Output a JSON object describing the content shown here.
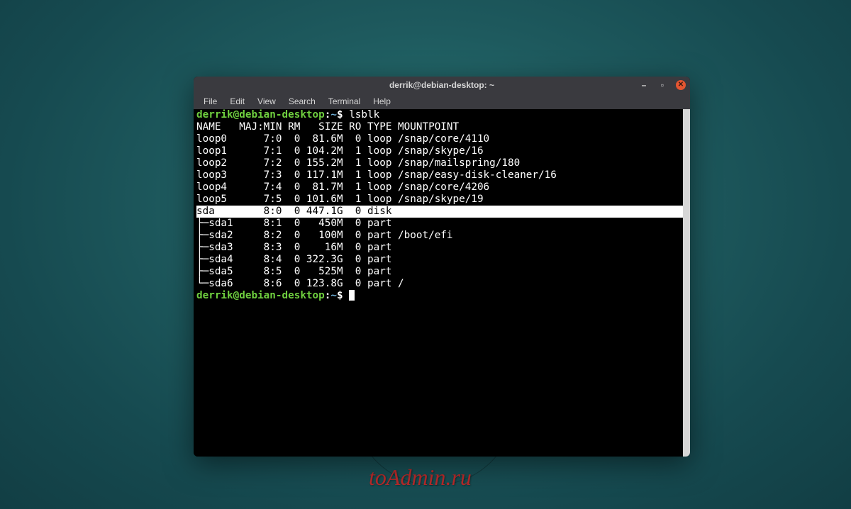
{
  "watermark": "toAdmin.ru",
  "window": {
    "title": "derrik@debian-desktop: ~",
    "controls": {
      "minimize": "–",
      "maximize": "▫",
      "close": "✕"
    }
  },
  "menu": [
    "File",
    "Edit",
    "View",
    "Search",
    "Terminal",
    "Help"
  ],
  "prompt": {
    "user_host": "derrik@debian-desktop",
    "separator": ":",
    "cwd": "~",
    "symbol": "$"
  },
  "command": "lsblk",
  "columns": [
    "NAME",
    "MAJ:MIN",
    "RM",
    "SIZE",
    "RO",
    "TYPE",
    "MOUNTPOINT"
  ],
  "rows": [
    {
      "name": "loop0",
      "prefix": "",
      "majmin": "7:0",
      "rm": "0",
      "size": "81.6M",
      "ro": "0",
      "type": "loop",
      "mount": "/snap/core/4110",
      "highlight": false
    },
    {
      "name": "loop1",
      "prefix": "",
      "majmin": "7:1",
      "rm": "0",
      "size": "104.2M",
      "ro": "1",
      "type": "loop",
      "mount": "/snap/skype/16",
      "highlight": false
    },
    {
      "name": "loop2",
      "prefix": "",
      "majmin": "7:2",
      "rm": "0",
      "size": "155.2M",
      "ro": "1",
      "type": "loop",
      "mount": "/snap/mailspring/180",
      "highlight": false
    },
    {
      "name": "loop3",
      "prefix": "",
      "majmin": "7:3",
      "rm": "0",
      "size": "117.1M",
      "ro": "1",
      "type": "loop",
      "mount": "/snap/easy-disk-cleaner/16",
      "highlight": false
    },
    {
      "name": "loop4",
      "prefix": "",
      "majmin": "7:4",
      "rm": "0",
      "size": "81.7M",
      "ro": "1",
      "type": "loop",
      "mount": "/snap/core/4206",
      "highlight": false
    },
    {
      "name": "loop5",
      "prefix": "",
      "majmin": "7:5",
      "rm": "0",
      "size": "101.6M",
      "ro": "1",
      "type": "loop",
      "mount": "/snap/skype/19",
      "highlight": false
    },
    {
      "name": "sda",
      "prefix": "",
      "majmin": "8:0",
      "rm": "0",
      "size": "447.1G",
      "ro": "0",
      "type": "disk",
      "mount": "",
      "highlight": true
    },
    {
      "name": "sda1",
      "prefix": "├─",
      "majmin": "8:1",
      "rm": "0",
      "size": "450M",
      "ro": "0",
      "type": "part",
      "mount": "",
      "highlight": false
    },
    {
      "name": "sda2",
      "prefix": "├─",
      "majmin": "8:2",
      "rm": "0",
      "size": "100M",
      "ro": "0",
      "type": "part",
      "mount": "/boot/efi",
      "highlight": false
    },
    {
      "name": "sda3",
      "prefix": "├─",
      "majmin": "8:3",
      "rm": "0",
      "size": "16M",
      "ro": "0",
      "type": "part",
      "mount": "",
      "highlight": false
    },
    {
      "name": "sda4",
      "prefix": "├─",
      "majmin": "8:4",
      "rm": "0",
      "size": "322.3G",
      "ro": "0",
      "type": "part",
      "mount": "",
      "highlight": false
    },
    {
      "name": "sda5",
      "prefix": "├─",
      "majmin": "8:5",
      "rm": "0",
      "size": "525M",
      "ro": "0",
      "type": "part",
      "mount": "",
      "highlight": false
    },
    {
      "name": "sda6",
      "prefix": "└─",
      "majmin": "8:6",
      "rm": "0",
      "size": "123.8G",
      "ro": "0",
      "type": "part",
      "mount": "/",
      "highlight": false
    }
  ]
}
